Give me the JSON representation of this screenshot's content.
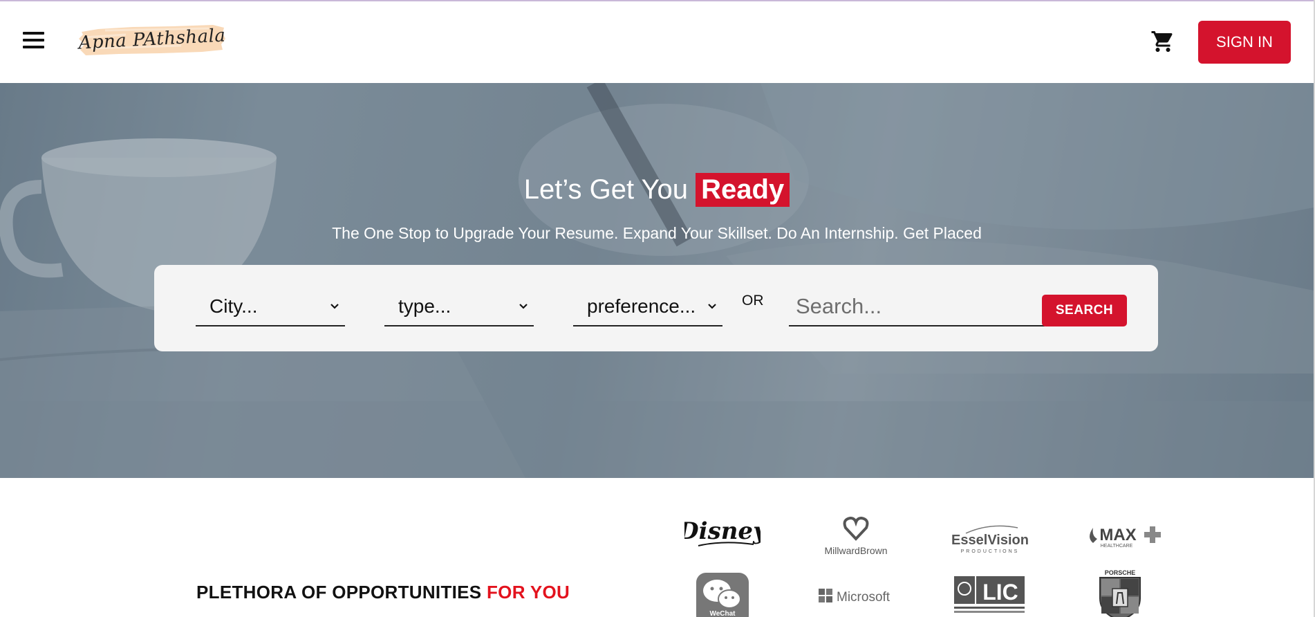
{
  "header": {
    "menu_icon": "hamburger-menu-icon",
    "logo_text": "Apna PAthshala",
    "cart_icon": "shopping-cart-icon",
    "signin_label": "SIGN IN"
  },
  "hero": {
    "title_plain": "Let’s Get You",
    "title_highlight": "Ready",
    "subtitle": "The One Stop to Upgrade Your Resume. Expand Your Skillset. Do An Internship. Get Placed"
  },
  "search": {
    "city_placeholder": "City...",
    "type_placeholder": "type...",
    "preference_placeholder": "preference...",
    "or_text": "OR",
    "search_placeholder": "Search...",
    "search_button": "SEARCH"
  },
  "opportunities": {
    "heading_plain": "PLETHORA OF OPPORTUNITIES",
    "heading_highlight": "FOR YOU"
  },
  "brands": {
    "disney": "Disney",
    "millward_top": "Millward",
    "millward_bottom": "Brown",
    "esselvision": "EsselVision",
    "esselvision_sub": "PRODUCTIONS",
    "max": "MAX",
    "max_sub": "HEALTHCARE",
    "wechat": "WeChat",
    "microsoft": "Microsoft",
    "lic": "LIC",
    "porsche": "PORSCHE"
  },
  "colors": {
    "accent": "#d4132d",
    "highlight_red": "#e3121d",
    "search_panel": "#f4f4f4",
    "logo_brush": "#f9d9b8"
  }
}
